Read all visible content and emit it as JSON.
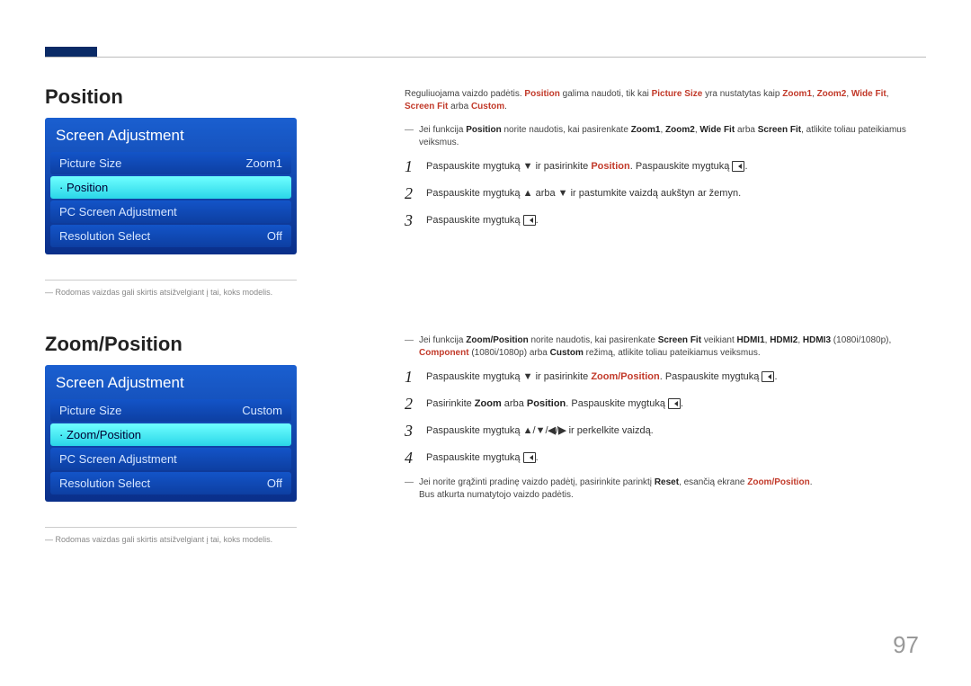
{
  "page_number": "97",
  "position": {
    "title": "Position",
    "menu_header": "Screen Adjustment",
    "rows": [
      {
        "label": "Picture Size",
        "value": "Zoom1",
        "highlight": false
      },
      {
        "label": "· Position",
        "value": "",
        "highlight": true
      },
      {
        "label": "PC Screen Adjustment",
        "value": "",
        "highlight": false
      },
      {
        "label": "Resolution Select",
        "value": "Off",
        "highlight": false
      }
    ],
    "footnote": "Rodomas vaizdas gali skirtis atsižvelgiant į tai, koks modelis."
  },
  "zoom_position": {
    "title": "Zoom/Position",
    "menu_header": "Screen Adjustment",
    "rows": [
      {
        "label": "Picture Size",
        "value": "Custom",
        "highlight": false
      },
      {
        "label": "· Zoom/Position",
        "value": "",
        "highlight": true
      },
      {
        "label": "PC Screen Adjustment",
        "value": "",
        "highlight": false
      },
      {
        "label": "Resolution Select",
        "value": "Off",
        "highlight": false
      }
    ],
    "footnote": "Rodomas vaizdas gali skirtis atsižvelgiant į tai, koks modelis."
  },
  "right": {
    "intro_pre": "Reguliuojama vaizdo padėtis. ",
    "intro_mid": " galima naudoti, tik kai ",
    "intro_post": " yra nustatytas kaip ",
    "intro_end": " arba ",
    "terms": {
      "position": "Position",
      "picture_size": "Picture Size",
      "zoom1": "Zoom1",
      "zoom2": "Zoom2",
      "wide_fit": "Wide Fit",
      "screen_fit": "Screen Fit",
      "custom": "Custom",
      "zoom_position": "Zoom/Position",
      "hdmi1": "HDMI1",
      "hdmi2": "HDMI2",
      "hdmi3": "HDMI3",
      "hd": "(1080i/1080p)",
      "component": "Component",
      "reset": "Reset",
      "zoom": "Zoom"
    },
    "dash1_a": "Jei funkcija ",
    "dash1_b": " norite naudotis, kai pasirenkate ",
    "dash1_c": ", atlikite toliau pateikiamus veiksmus.",
    "s1_a": "Paspauskite mygtuką ",
    "s1_b": " ir pasirinkite ",
    "s1_c": ". Paspauskite mygtuką ",
    "s2_a": "Paspauskite mygtuką ",
    "s2_mid": " arba ",
    "s2_b": " ir pastumkite vaizdą aukštyn ar žemyn.",
    "s3_a": "Paspauskite mygtuką ",
    "dash2_a": "Jei funkcija ",
    "dash2_b": " norite naudotis, kai pasirenkate ",
    "dash2_veik": " veikiant ",
    "dash2_arba": " arba ",
    "dash2_rez": " režimą, atlikite toliau pateikiamus veiksmus.",
    "z1_a": "Paspauskite mygtuką ",
    "z1_b": " ir pasirinkite ",
    "z1_c": ". Paspauskite mygtuką ",
    "z2_a": "Pasirinkite ",
    "z2_arba": " arba ",
    "z2_c": ". Paspauskite mygtuką ",
    "z3_a": "Paspauskite mygtuką ",
    "z3_b": " ir perkelkite vaizdą.",
    "z4_a": "Paspauskite mygtuką ",
    "final_a": "Jei norite grąžinti pradinę vaizdo padėtį, pasirinkite parinktį ",
    "final_b": ", esančią ekrane ",
    "final_c": "Bus atkurta numatytojo vaizdo padėtis.",
    "nums": {
      "n1": "1",
      "n2": "2",
      "n3": "3",
      "n4": "4"
    },
    "sep_comma": ", ",
    "sep_dot": "."
  }
}
